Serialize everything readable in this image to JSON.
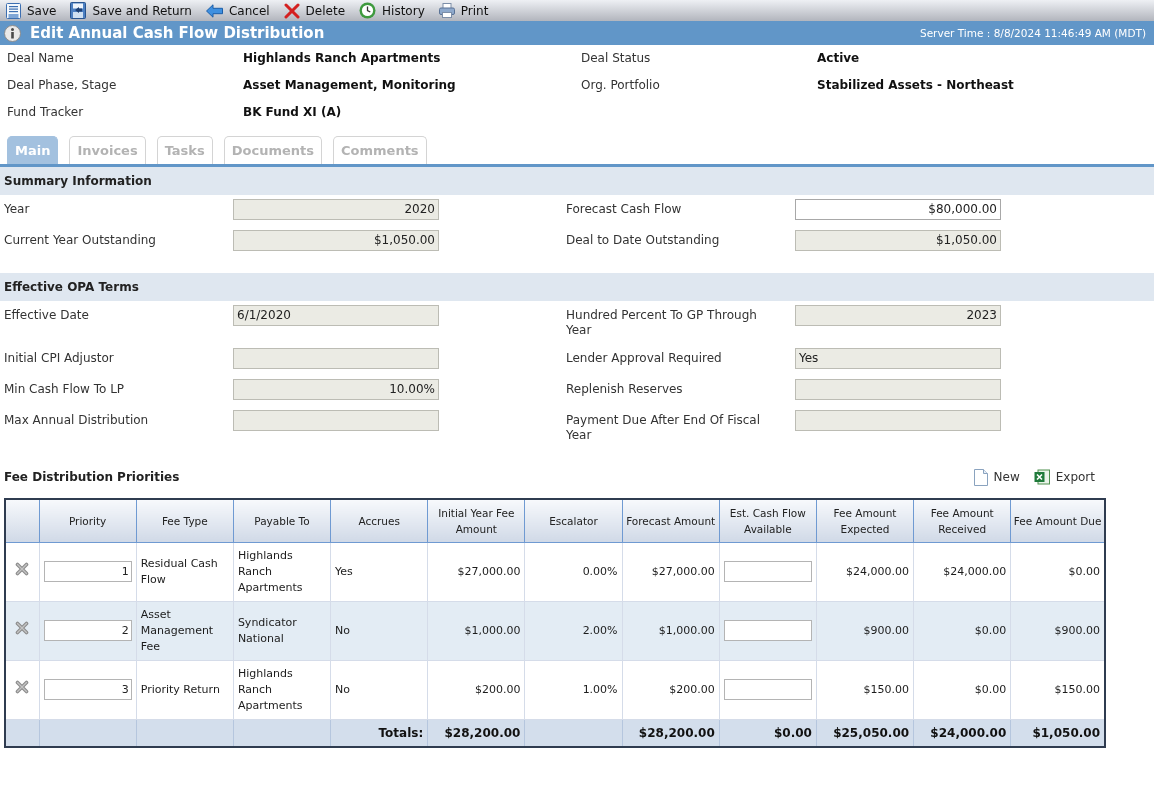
{
  "toolbar": [
    {
      "label": "Save"
    },
    {
      "label": "Save and Return"
    },
    {
      "label": "Cancel"
    },
    {
      "label": "Delete"
    },
    {
      "label": "History"
    },
    {
      "label": "Print"
    }
  ],
  "header": {
    "title": "Edit Annual Cash Flow Distribution",
    "server_time": "Server Time : 8/8/2024 11:46:49 AM (MDT)"
  },
  "deal_info": [
    {
      "label": "Deal Name",
      "value": "Highlands Ranch Apartments"
    },
    {
      "label": "Deal Status",
      "value": "Active"
    },
    {
      "label": "Deal Phase, Stage",
      "value": "Asset Management, Monitoring"
    },
    {
      "label": "Org. Portfolio",
      "value": "Stabilized Assets - Northeast"
    },
    {
      "label": "Fund Tracker",
      "value": "BK Fund XI (A)"
    }
  ],
  "tabs": [
    {
      "label": "Main",
      "selected": true
    },
    {
      "label": "Invoices",
      "selected": false
    },
    {
      "label": "Tasks",
      "selected": false
    },
    {
      "label": "Documents",
      "selected": false
    },
    {
      "label": "Comments",
      "selected": false
    }
  ],
  "summary": {
    "title": "Summary Information",
    "fields": [
      {
        "label": "Year",
        "value": "2020",
        "kind": "number",
        "editable": false
      },
      {
        "label": "Forecast Cash Flow",
        "value": "$80,000.00",
        "kind": "number",
        "editable": true
      },
      {
        "label": "Current Year Outstanding",
        "value": "$1,050.00",
        "kind": "number",
        "editable": false
      },
      {
        "label": "Deal to Date Outstanding",
        "value": "$1,050.00",
        "kind": "number",
        "editable": false
      }
    ]
  },
  "opa_terms": {
    "title": "Effective OPA Terms",
    "fields": [
      {
        "label": "Effective Date",
        "value": "6/1/2020",
        "kind": "text",
        "editable": false
      },
      {
        "label": "Hundred Percent To GP Through Year",
        "value": "2023",
        "kind": "number",
        "editable": false
      },
      {
        "label": "Initial CPI Adjustor",
        "editable": false
      },
      {
        "label": "Lender Approval Required",
        "value": "Yes",
        "kind": "text",
        "editable": false
      },
      {
        "label": "Min Cash Flow To LP",
        "value": "10.00%",
        "kind": "number",
        "editable": false
      },
      {
        "label": "Replenish Reserves",
        "editable": false
      },
      {
        "label": "Max Annual Distribution",
        "editable": false
      },
      {
        "label": "Payment Due After End Of Fiscal Year",
        "editable": false
      }
    ]
  },
  "fee_table": {
    "title": "Fee Distribution Priorities",
    "actions": [
      {
        "label": "New"
      },
      {
        "label": "Export"
      }
    ],
    "columns": [
      "Priority",
      "Fee Type",
      "Payable To",
      "Accrues",
      "Initial Year Fee Amount",
      "Escalator",
      "Forecast Amount",
      "Est. Cash Flow Available",
      "Fee Amount Expected",
      "Fee Amount Received",
      "Fee Amount Due"
    ],
    "rows": [
      {
        "priority": "1",
        "fee_type": "Residual Cash Flow",
        "payable_to": "Highlands Ranch Apartments",
        "accrues": "Yes",
        "initial_year_fee_amount": "$27,000.00",
        "escalator": "0.00%",
        "forecast_amount": "$27,000.00",
        "fee_amount_expected": "$24,000.00",
        "fee_amount_received": "$24,000.00",
        "fee_amount_due": "$0.00"
      },
      {
        "priority": "2",
        "fee_type": "Asset Management Fee",
        "payable_to": "Syndicator National",
        "accrues": "No",
        "initial_year_fee_amount": "$1,000.00",
        "escalator": "2.00%",
        "forecast_amount": "$1,000.00",
        "fee_amount_expected": "$900.00",
        "fee_amount_received": "$0.00",
        "fee_amount_due": "$900.00"
      },
      {
        "priority": "3",
        "fee_type": "Priority Return",
        "payable_to": "Highlands Ranch Apartments",
        "accrues": "No",
        "initial_year_fee_amount": "$200.00",
        "escalator": "1.00%",
        "forecast_amount": "$200.00",
        "fee_amount_expected": "$150.00",
        "fee_amount_received": "$0.00",
        "fee_amount_due": "$150.00"
      }
    ],
    "totals": {
      "label": "Totals:",
      "initial_year_fee_amount": "$28,200.00",
      "forecast_amount": "$28,200.00",
      "est_cash_flow_available": "$0.00",
      "fee_amount_expected": "$25,050.00",
      "fee_amount_received": "$24,000.00",
      "fee_amount_due": "$1,050.00"
    }
  }
}
